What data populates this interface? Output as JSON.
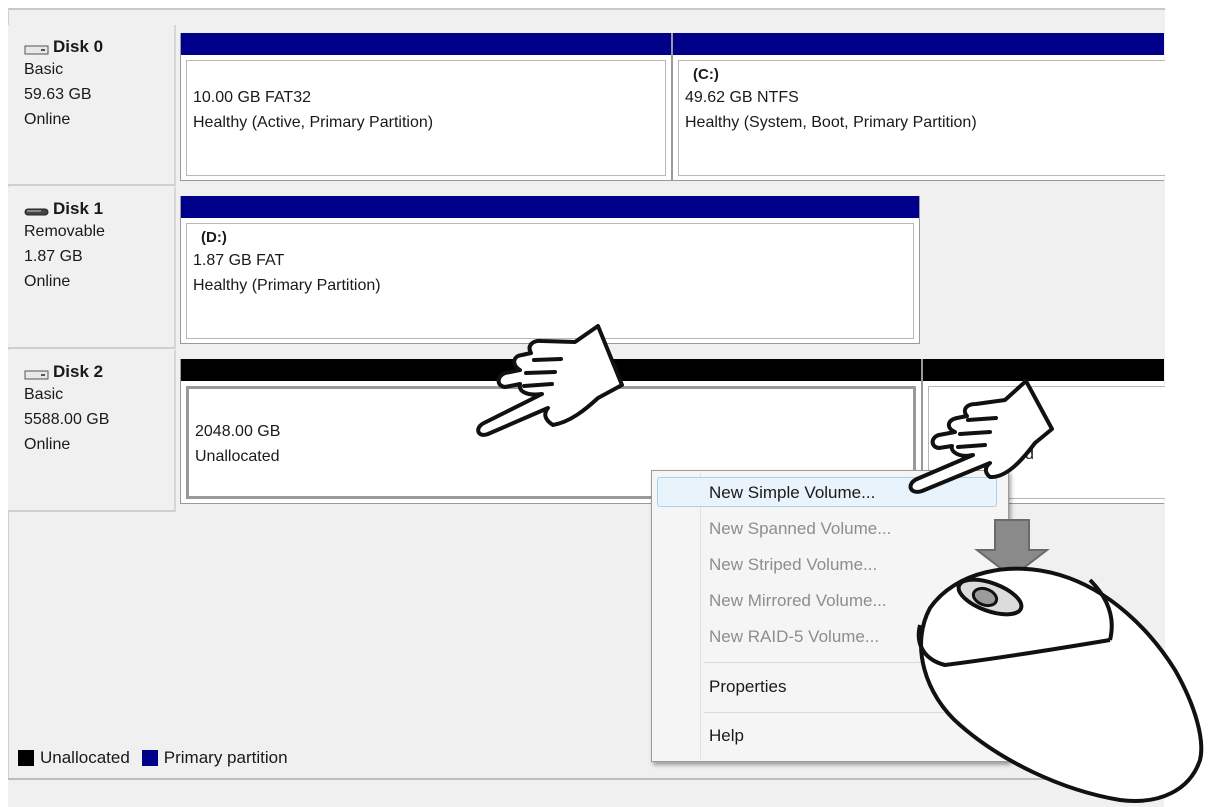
{
  "legend": {
    "unallocated_label": "Unallocated",
    "primary_label": "Primary partition",
    "unallocated_color": "#000000",
    "primary_color": "#00008b"
  },
  "disks": [
    {
      "name": "Disk 0",
      "type": "Basic",
      "size": "59.63 GB",
      "status": "Online",
      "icon": "hard-disk-icon",
      "partitions": [
        {
          "letter": "",
          "size": "10.00 GB FAT32",
          "status": "Healthy (Active, Primary Partition)"
        },
        {
          "letter": "(C:)",
          "size": "49.62 GB NTFS",
          "status": "Healthy (System, Boot, Primary Partition)"
        }
      ]
    },
    {
      "name": "Disk 1",
      "type": "Removable",
      "size": "1.87 GB",
      "status": "Online",
      "icon": "removable-disk-icon",
      "partitions": [
        {
          "letter": "(D:)",
          "size": "1.87 GB FAT",
          "status": "Healthy (Primary Partition)"
        }
      ]
    },
    {
      "name": "Disk 2",
      "type": "Basic",
      "size": "5588.00 GB",
      "status": "Online",
      "icon": "hard-disk-icon",
      "partitions": [
        {
          "size": "2048.00 GB",
          "status": "Unallocated"
        },
        {
          "status_visible_fragment": "d"
        }
      ]
    }
  ],
  "context_menu": {
    "items": [
      {
        "label": "New Simple Volume...",
        "enabled": true,
        "highlighted": true
      },
      {
        "label": "New Spanned Volume...",
        "enabled": false
      },
      {
        "label": "New Striped Volume...",
        "enabled": false
      },
      {
        "label": "New Mirrored Volume...",
        "enabled": false
      },
      {
        "label": "New RAID-5 Volume...",
        "enabled": false
      },
      {
        "label": "Properties",
        "enabled": true
      },
      {
        "label": "Help",
        "enabled": true
      }
    ]
  }
}
